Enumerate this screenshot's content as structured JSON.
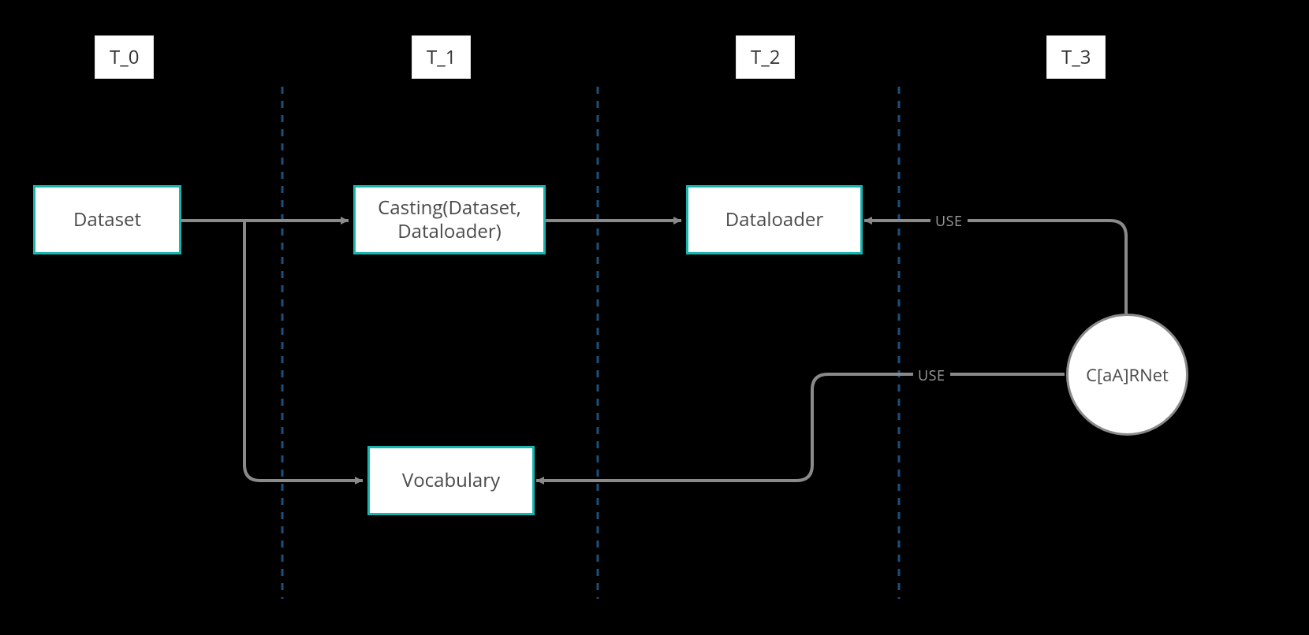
{
  "phases": {
    "t0": "T_0",
    "t1": "T_1",
    "t2": "T_2",
    "t3": "T_3"
  },
  "nodes": {
    "dataset": "Dataset",
    "casting": "Casting(Dataset, Dataloader)",
    "dataloader": "Dataloader",
    "vocabulary": "Vocabulary",
    "carnet": "C[aA]RNet"
  },
  "edges": {
    "use1": "USE",
    "use2": "USE"
  },
  "colors": {
    "nodeBorder": "#16b5b0",
    "circleBorder": "#8a8a8a",
    "divider": "#1d4f7a",
    "arrow": "#8a8a8a"
  }
}
